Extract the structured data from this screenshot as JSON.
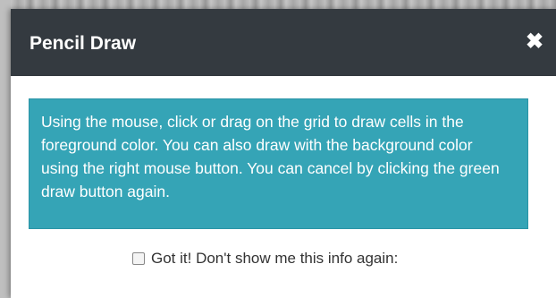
{
  "dialog": {
    "title": "Pencil Draw",
    "close_icon": "close-icon",
    "close_glyph": "✖",
    "info_text": "Using the mouse, click or drag on the grid to draw cells in the foreground color. You can also draw with the background color using the right mouse button. You can cancel by clicking the green draw button again.",
    "dont_show_label": "Got it! Don't show me this info again:",
    "dont_show_checked": false
  },
  "colors": {
    "header_bg": "#343a40",
    "info_bg": "#35a4b6",
    "info_text": "#ffffff"
  }
}
